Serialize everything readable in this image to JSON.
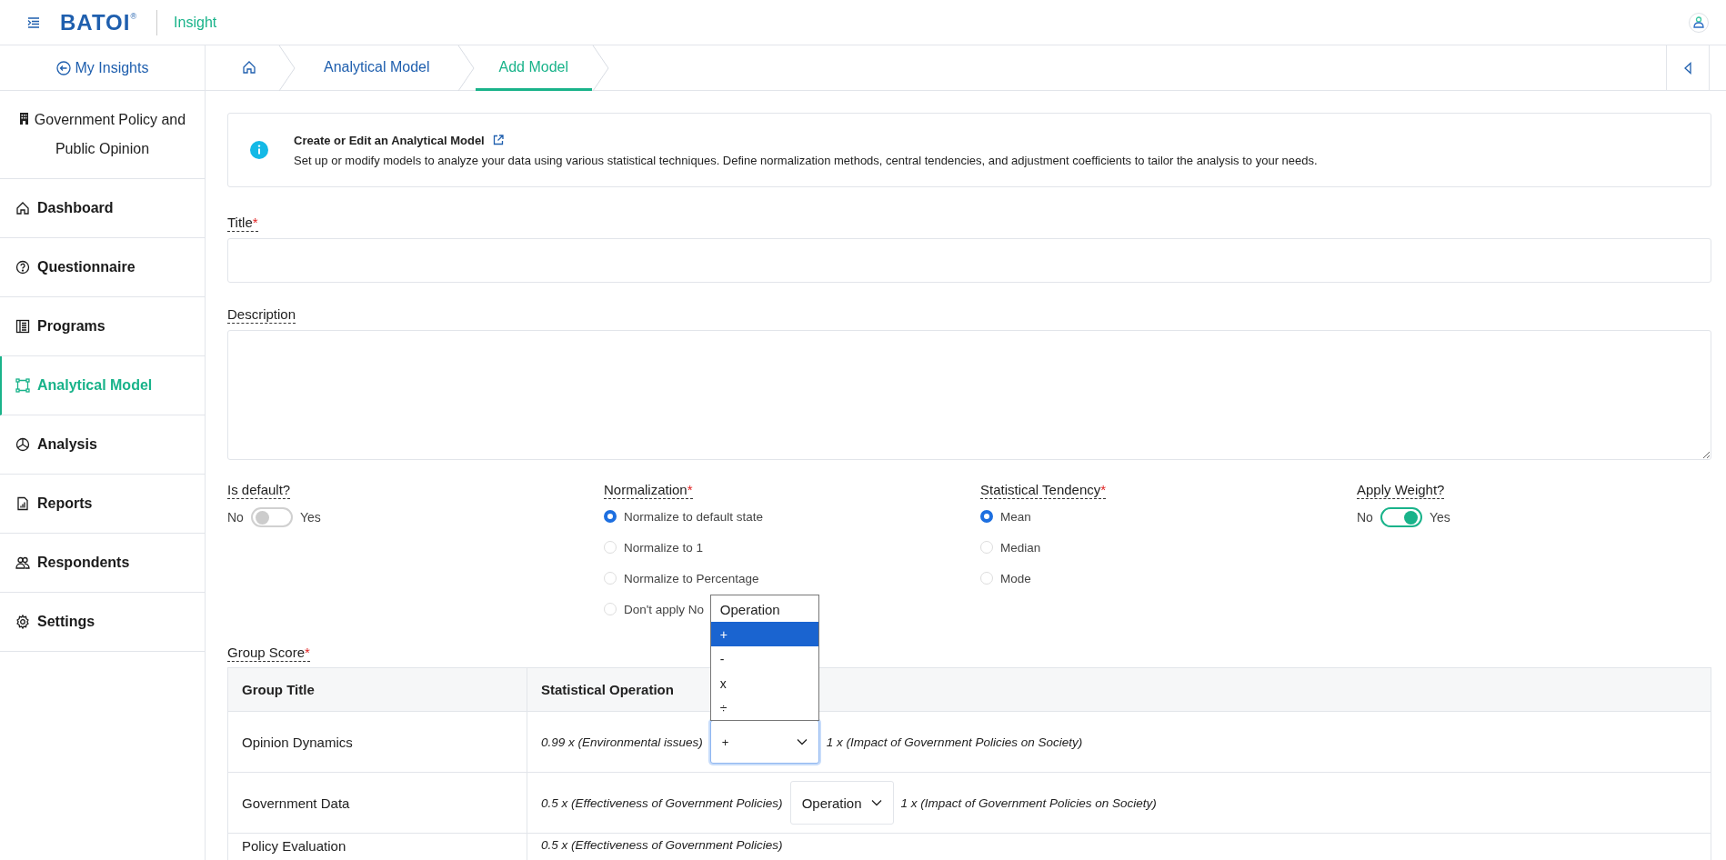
{
  "header": {
    "logo": "BATOI",
    "registered": "®",
    "app_name": "Insight"
  },
  "sidebar": {
    "back_link": "My Insights",
    "project": "Government Policy and Public Opinion",
    "items": [
      {
        "label": "Dashboard",
        "selected": false
      },
      {
        "label": "Questionnaire",
        "selected": false
      },
      {
        "label": "Programs",
        "selected": false
      },
      {
        "label": "Analytical Model",
        "selected": true
      },
      {
        "label": "Analysis",
        "selected": false
      },
      {
        "label": "Reports",
        "selected": false
      },
      {
        "label": "Respondents",
        "selected": false
      },
      {
        "label": "Settings",
        "selected": false
      }
    ]
  },
  "breadcrumb": [
    {
      "label": "Analytical Model",
      "selected": false
    },
    {
      "label": "Add Model",
      "selected": true
    }
  ],
  "info": {
    "title": "Create or Edit an Analytical Model",
    "text": "Set up or modify models to analyze your data using various statistical techniques. Define normalization methods, central tendencies, and adjustment coefficients to tailor the analysis to your needs."
  },
  "title_field": {
    "label": "Title",
    "mark": "*"
  },
  "description_field": {
    "label": "Description"
  },
  "options": [
    {
      "kind": "toggle",
      "label": "Is default?",
      "off_label": "No",
      "on_label": "Yes",
      "on": false
    },
    {
      "kind": "radio",
      "label": "Normalization",
      "mark": "*",
      "choices": [
        {
          "label": "Normalize to default state",
          "selected": true
        },
        {
          "label": "Normalize to 1",
          "selected": false
        },
        {
          "label": "Normalize to Percentage",
          "selected": false
        },
        {
          "label": "Don't apply No",
          "selected": false
        }
      ]
    },
    {
      "kind": "radio",
      "label": "Statistical Tendency",
      "mark": "*",
      "choices": [
        {
          "label": "Mean",
          "selected": true
        },
        {
          "label": "Median",
          "selected": false
        },
        {
          "label": "Mode",
          "selected": false
        }
      ]
    },
    {
      "kind": "toggle",
      "label": "Apply Weight?",
      "off_label": "No",
      "on_label": "Yes",
      "on": true
    }
  ],
  "group_score": {
    "label": "Group Score",
    "mark": "*",
    "columns": [
      "Group Title",
      "Statistical Operation"
    ],
    "rows": [
      {
        "title": "Opinion Dynamics",
        "left": "0.99 x (Environmental issues)",
        "operator": {
          "value": "+",
          "focused": true
        },
        "right": "1 x (Impact of Government Policies on Society)"
      },
      {
        "title": "Government Data",
        "left": "0.5 x (Effectiveness of Government Policies)",
        "operator": {
          "value": "Operation",
          "focused": false
        },
        "right": "1 x (Impact of Government Policies on Society)"
      },
      {
        "title": "Policy Evaluation",
        "left": "0.5 x (Effectiveness of Government Policies)"
      }
    ]
  },
  "operator_menu": {
    "options": [
      {
        "label": "Operation",
        "selected": false
      },
      {
        "label": "+",
        "selected": true
      },
      {
        "label": "-",
        "selected": false
      },
      {
        "label": "x",
        "selected": false
      },
      {
        "label": "÷",
        "selected": false
      }
    ]
  }
}
